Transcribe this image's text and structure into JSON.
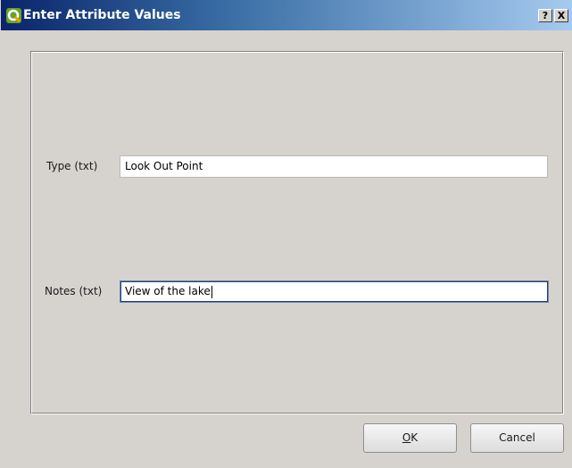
{
  "window": {
    "title": "Enter Attribute Values",
    "icon": "qgis-q-icon",
    "help_label": "?",
    "close_label": "X"
  },
  "form": {
    "fields": [
      {
        "label": "Type (txt)",
        "value": "Look Out Point"
      },
      {
        "label": "Notes (txt)",
        "value": "View of the lake"
      }
    ]
  },
  "buttons": {
    "ok_mnemonic": "O",
    "ok_rest": "K",
    "cancel_label": "Cancel"
  },
  "colors": {
    "titlebar_start": "#0a246a",
    "titlebar_end": "#a6caf0",
    "icon_green": "#6aa22a",
    "icon_orange": "#f0a000"
  }
}
